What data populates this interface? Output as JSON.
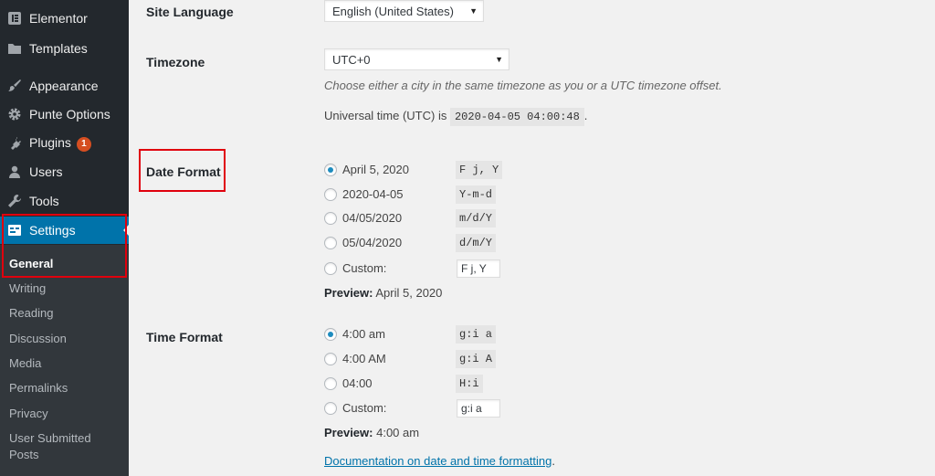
{
  "sidebar": {
    "items": [
      {
        "label": "Elementor",
        "icon": "elementor-icon"
      },
      {
        "label": "Templates",
        "icon": "folder-icon"
      },
      {
        "label": "Appearance",
        "icon": "paintbrush-icon"
      },
      {
        "label": "Punte Options",
        "icon": "gear-icon"
      },
      {
        "label": "Plugins",
        "icon": "plug-icon",
        "badge": "1"
      },
      {
        "label": "Users",
        "icon": "user-icon"
      },
      {
        "label": "Tools",
        "icon": "wrench-icon"
      },
      {
        "label": "Settings",
        "icon": "settings-icon",
        "active": true
      }
    ],
    "submenu": [
      "General",
      "Writing",
      "Reading",
      "Discussion",
      "Media",
      "Permalinks",
      "Privacy",
      "User Submitted",
      "Posts"
    ]
  },
  "site_language": {
    "label": "Site Language",
    "value": "English (United States)"
  },
  "timezone": {
    "label": "Timezone",
    "value": "UTC+0",
    "description": "Choose either a city in the same timezone as you or a UTC timezone offset.",
    "utc_prefix": "Universal time (UTC) is",
    "utc_value": "2020-04-05 04:00:48",
    "utc_suffix": "."
  },
  "date_format": {
    "label": "Date Format",
    "options": [
      {
        "label": "April 5, 2020",
        "code": "F j, Y",
        "checked": true
      },
      {
        "label": "2020-04-05",
        "code": "Y-m-d"
      },
      {
        "label": "04/05/2020",
        "code": "m/d/Y"
      },
      {
        "label": "05/04/2020",
        "code": "d/m/Y"
      },
      {
        "label": "Custom:",
        "input": "F j, Y"
      }
    ],
    "preview_label": "Preview:",
    "preview_value": "April 5, 2020"
  },
  "time_format": {
    "label": "Time Format",
    "options": [
      {
        "label": "4:00 am",
        "code": "g:i a",
        "checked": true
      },
      {
        "label": "4:00 AM",
        "code": "g:i A"
      },
      {
        "label": "04:00",
        "code": "H:i"
      },
      {
        "label": "Custom:",
        "input": "g:i a"
      }
    ],
    "preview_label": "Preview:",
    "preview_value": "4:00 am"
  },
  "doc_link": {
    "text": "Documentation on date and time formatting",
    "suffix": "."
  },
  "colors": {
    "sidebar": "#23282d",
    "submenu": "#32373c",
    "active": "#0073aa",
    "link": "#0073aa",
    "highlight": "#e0000d",
    "badge": "#d54e21"
  }
}
